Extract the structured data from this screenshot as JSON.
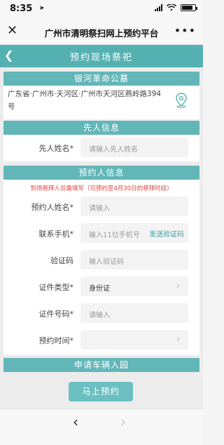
{
  "status": {
    "time": "8:35",
    "battery_level": 0.85
  },
  "wechat": {
    "title": "广州市清明祭扫网上预约平台",
    "close_icon": "close-icon",
    "more_icon": "more-dots-icon"
  },
  "header": {
    "title": "预约现场祭祀",
    "back_icon": "chevron-left-icon"
  },
  "cemetery": {
    "name": "银河革命公墓",
    "address": "广东省·广州市·天河区·广州市天河区燕岭路394号",
    "icon": "location-pin-icon"
  },
  "deceased": {
    "section_title": "先人信息",
    "name_label": "先人姓名",
    "name_placeholder": "请输入先人姓名"
  },
  "booker": {
    "section_title": "预约人信息",
    "notice": "到场祭拜人员需填写（可预约至4月30日的祭拜时段）",
    "required_mark": "*",
    "name_label": "预约人姓名",
    "name_placeholder": "请输入",
    "phone_label": "联系手机",
    "phone_placeholder": "输入11位手机号",
    "send_code": "发送验证码",
    "code_label": "验证码",
    "code_placeholder": "输入验证码",
    "idtype_label": "证件类型",
    "idtype_value": "身份证",
    "idno_label": "证件号码",
    "idno_placeholder": "请输入",
    "time_label": "预约时间",
    "time_value": ""
  },
  "vehicle": {
    "section_title": "申请车辆入园"
  },
  "actions": {
    "submit": "马上预约"
  },
  "colors": {
    "teal": "#55b0b2",
    "section_teal": "#62b6b8",
    "button_teal": "#6bbfc1",
    "notice_red": "#e53c3c"
  }
}
